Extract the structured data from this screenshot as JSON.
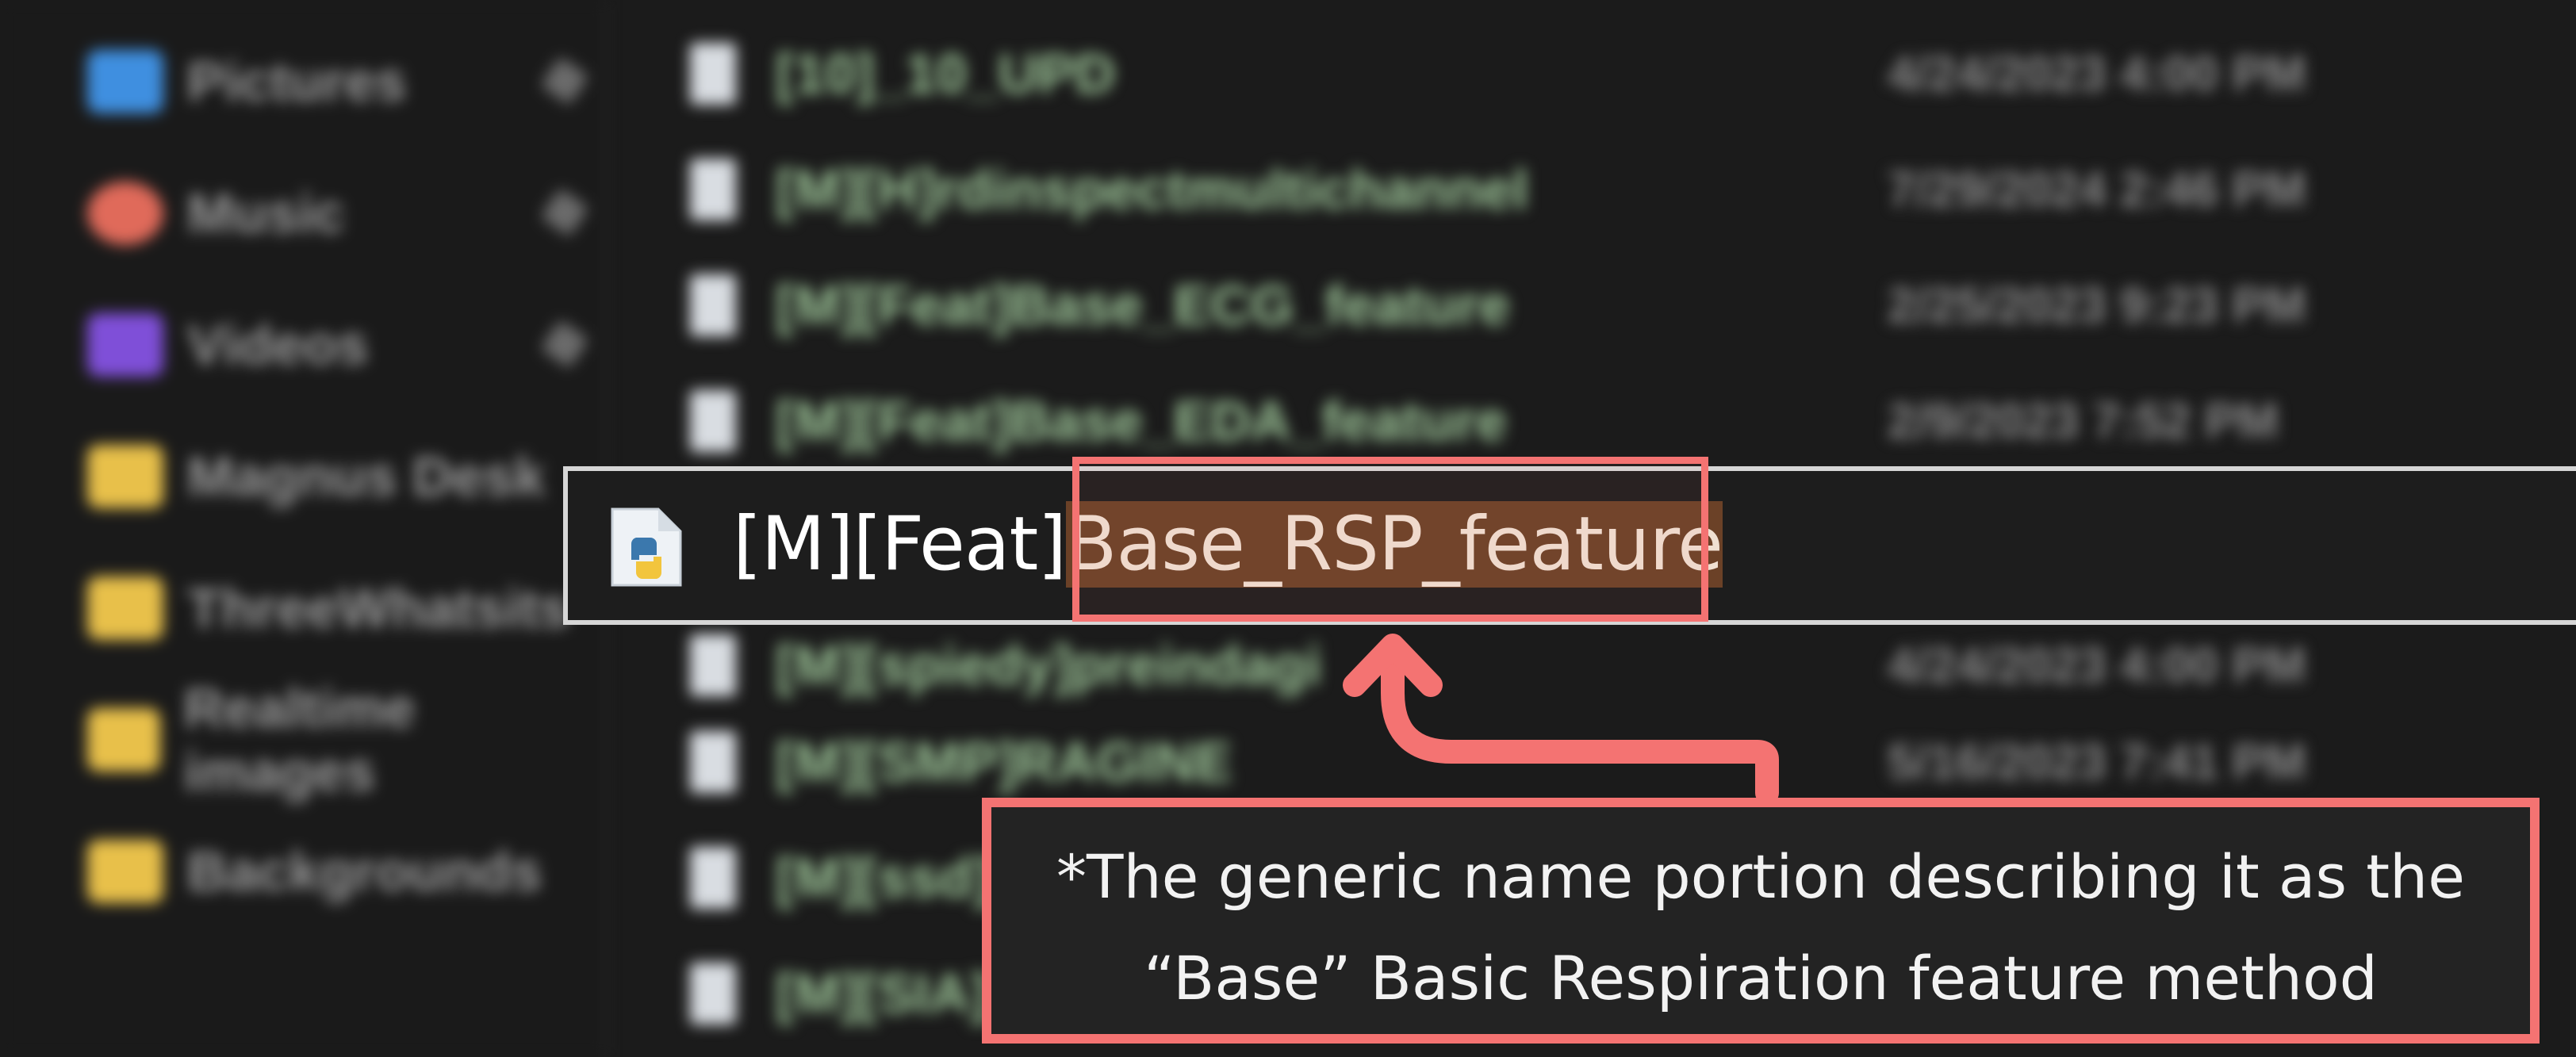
{
  "sidebar": {
    "items": [
      {
        "label": "Pictures",
        "icon": "pictures-icon",
        "color": "#3f8fe0",
        "pinned": true
      },
      {
        "label": "Music",
        "icon": "music-icon",
        "color": "#e06a5a",
        "pinned": true
      },
      {
        "label": "Videos",
        "icon": "videos-icon",
        "color": "#7f4fd8",
        "pinned": true
      },
      {
        "label": "Magnus Desk",
        "icon": "folder-icon",
        "color": "#e8c04a",
        "pinned": false
      },
      {
        "label": "ThreeWhatsits",
        "icon": "folder-icon",
        "color": "#e8c04a",
        "pinned": false
      },
      {
        "label": "Realtime images",
        "icon": "folder-icon",
        "color": "#e8c04a",
        "pinned": false
      },
      {
        "label": "Backgrounds",
        "icon": "folder-icon",
        "color": "#e8c04a",
        "pinned": false
      }
    ]
  },
  "files": [
    {
      "name": "[10]_10_UPD",
      "date": "4/24/2023 4:00 PM"
    },
    {
      "name": "[M][H]rdinspectmultichannel",
      "date": "7/29/2024 2:46 PM"
    },
    {
      "name": "[M][Feat]Base_ECG_feature",
      "date": "2/25/2023 9:23 PM"
    },
    {
      "name": "[M][Feat]Base_EDA_feature",
      "date": "2/9/2023 7:52 PM"
    },
    {
      "name": "[M][Feat]Base_RSP_feature",
      "date": ""
    },
    {
      "name": "[M][spiedy]preindagi",
      "date": "4/24/2023 4:00 PM"
    },
    {
      "name": "[M][SMP]RAGINE",
      "date": "5/16/2023 7:41 PM"
    },
    {
      "name": "[M][ssd]",
      "date": ""
    },
    {
      "name": "[M][SIA]",
      "date": ""
    }
  ],
  "rename": {
    "prefix": "[M][Feat]",
    "selected": "Base_RSP_feature",
    "icon": "python-file-icon"
  },
  "callout": {
    "line1": "*The generic name portion describing it as the",
    "line2": "“Base” Basic Respiration feature method"
  },
  "colors": {
    "highlight": "#f47372",
    "selection": "#6b4127"
  }
}
